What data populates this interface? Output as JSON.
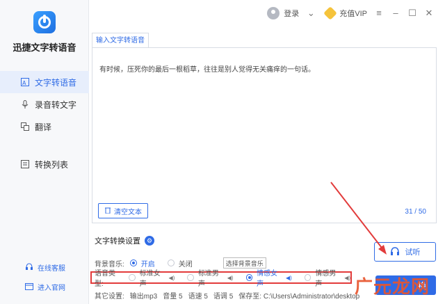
{
  "app": {
    "name": "迅捷文字转语音"
  },
  "sidebar": {
    "items": [
      {
        "label": "文字转语音",
        "icon": "text-to-speech-icon",
        "active": true
      },
      {
        "label": "录音转文字",
        "icon": "microphone-icon",
        "active": false
      },
      {
        "label": "翻译",
        "icon": "translate-icon",
        "active": false
      },
      {
        "label": "转换列表",
        "icon": "list-icon",
        "active": false
      }
    ],
    "bottom_links": [
      {
        "label": "在线客服",
        "icon": "headset-icon"
      },
      {
        "label": "进入官网",
        "icon": "website-icon"
      }
    ]
  },
  "topbar": {
    "login": "登录",
    "vip": "充值VIP"
  },
  "tab": {
    "label": "输入文字转语音"
  },
  "editor": {
    "text": "有时候，压死你的最后一根稻草，往往是别人觉得无关痛痒的一句话。",
    "clear_label": "清空文本",
    "counter": "31 / 50"
  },
  "settings": {
    "title": "文字转换设置",
    "bg_music_label": "背景音乐:",
    "bg_music_options": [
      "开启",
      "关闭"
    ],
    "bg_music_selected": "开启",
    "bg_music_button": "选择背景音乐",
    "voice_label": "语音类型:",
    "voice_options": [
      "标准女声",
      "标准男声",
      "情感女声",
      "情感男声"
    ],
    "voice_selected": "情感女声",
    "other_label": "其它设置:",
    "other_items": [
      "输出mp3",
      "音量 5",
      "语速 5",
      "语调 5",
      "保存至: C:\\Users\\Administrator\\desktop"
    ]
  },
  "actions": {
    "listen": "试听",
    "convert": "换"
  },
  "watermark": "广元龙网",
  "colors": {
    "accent": "#2f6be6",
    "highlight": "#e23b3b"
  }
}
